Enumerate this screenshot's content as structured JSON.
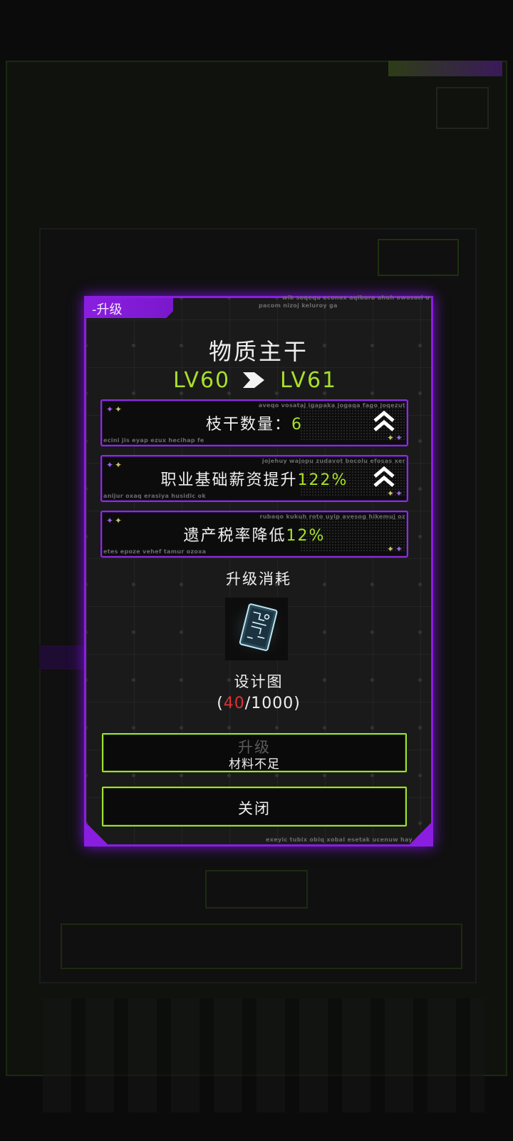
{
  "dialog": {
    "tab_label": "-升级",
    "deco_top": "wik soqequ econox aqibara ahuh owosori u",
    "deco_top2": "pacom nizoj keluroy ga",
    "deco_bottom": "exeyic tubix obiq xobal esetak ucenuw hay",
    "title": "物质主干",
    "level_from": "LV60",
    "level_to": "LV61",
    "stats": [
      {
        "label": "枝干数量：",
        "value": "6",
        "deco_top": "aveqo vosataj igapaka jogaqa fago joqezut",
        "deco_bottom": "ecini jis eyap ezux hecihap fe",
        "has_up_icon": true
      },
      {
        "label": "职业基础薪资提升",
        "value": "122%",
        "deco_top": "jojehuy wajopu zudavot bocolu efosas xer",
        "deco_bottom": "anijur oxaq erasiya husidic ok",
        "has_up_icon": true
      },
      {
        "label": "遗产税率降低",
        "value": "12%",
        "deco_top": "rubaqo kukuh roto uyip avesog hikemuj oz",
        "deco_bottom": "etes epoze vehef tamur ozoxa",
        "has_up_icon": false
      }
    ],
    "cost_title": "升级消耗",
    "item_name": "设计图",
    "item_count_open": "(",
    "item_have": "40",
    "item_need": "/1000)",
    "upgrade_button": {
      "label": "升级",
      "sublabel": "材料不足"
    },
    "close_button": {
      "label": "关闭"
    }
  },
  "colors": {
    "accent_purple": "#8a1ee0",
    "accent_green": "#a8e02a",
    "warning_red": "#e03030"
  }
}
